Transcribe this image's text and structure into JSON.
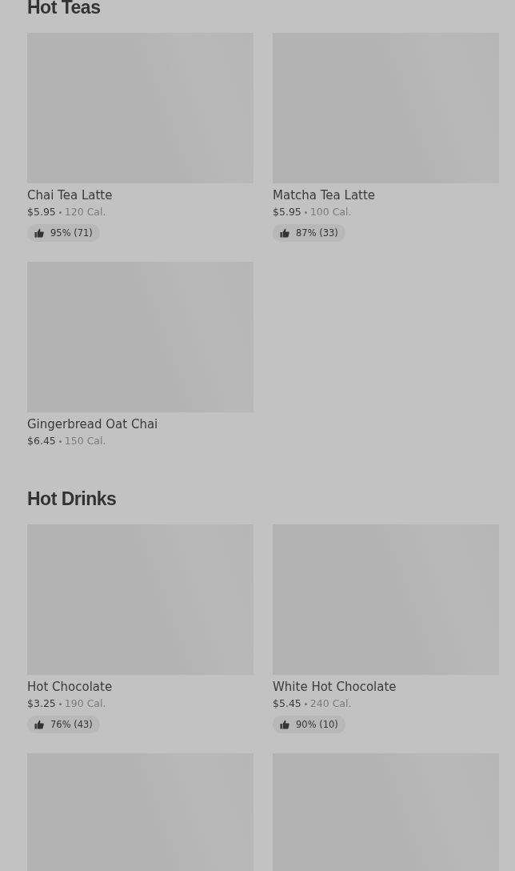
{
  "sections": [
    {
      "title": "Hot Teas",
      "items": [
        {
          "kind": "full",
          "name": "Chai Tea Latte",
          "price": "$5.95",
          "calories": "120 Cal.",
          "rating": "95% (71)"
        },
        {
          "kind": "full",
          "name": "Matcha Tea Latte",
          "price": "$5.95",
          "calories": "100 Cal.",
          "rating": "87% (33)"
        },
        {
          "kind": "full",
          "name": "Gingerbread Oat Chai",
          "price": "$6.45",
          "calories": "150 Cal."
        }
      ]
    },
    {
      "title": "Hot Drinks",
      "items": [
        {
          "kind": "full",
          "name": "Hot Chocolate",
          "price": "$3.25",
          "calories": "190 Cal.",
          "rating": "76% (43)"
        },
        {
          "kind": "full",
          "name": "White Hot Chocolate",
          "price": "$5.45",
          "calories": "240 Cal.",
          "rating": "90% (10)"
        },
        {
          "kind": "image_only"
        },
        {
          "kind": "image_only"
        }
      ]
    }
  ]
}
